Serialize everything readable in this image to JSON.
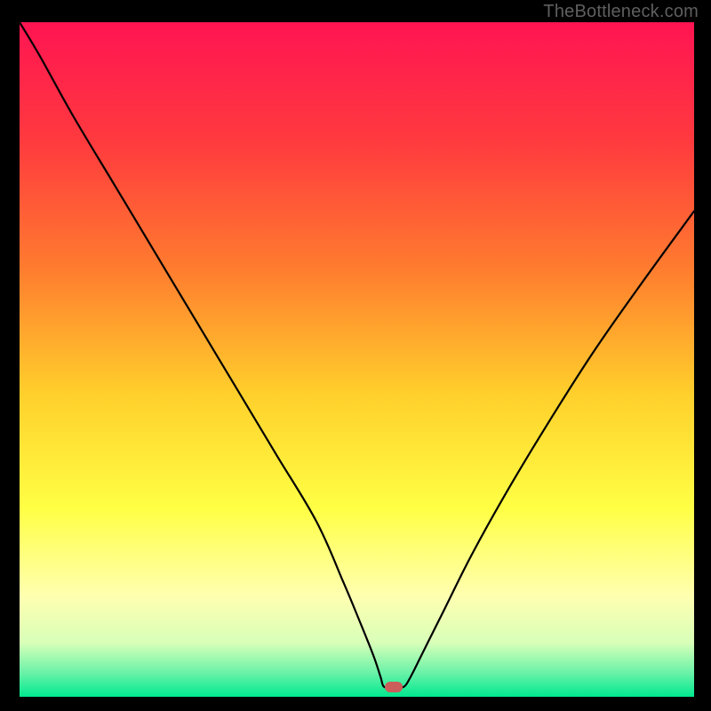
{
  "attribution": "TheBottleneck.com",
  "marker": {
    "x_frac": 0.555,
    "y_frac": 0.985
  },
  "chart_data": {
    "type": "line",
    "title": "",
    "xlabel": "",
    "ylabel": "",
    "xlim": [
      0,
      100
    ],
    "ylim": [
      0,
      100
    ],
    "grid": false,
    "legend": false,
    "gradient_stops": [
      {
        "offset": 0.0,
        "color": "#ff1452"
      },
      {
        "offset": 0.18,
        "color": "#ff3b3e"
      },
      {
        "offset": 0.36,
        "color": "#ff7a2f"
      },
      {
        "offset": 0.55,
        "color": "#ffcf2b"
      },
      {
        "offset": 0.72,
        "color": "#ffff44"
      },
      {
        "offset": 0.85,
        "color": "#ffffb0"
      },
      {
        "offset": 0.92,
        "color": "#d8ffb8"
      },
      {
        "offset": 0.965,
        "color": "#68f2a8"
      },
      {
        "offset": 1.0,
        "color": "#00e98f"
      }
    ],
    "series": [
      {
        "name": "bottleneck-curve",
        "x": [
          0.0,
          3.0,
          8.0,
          14.0,
          20.0,
          26.0,
          32.0,
          38.0,
          44.0,
          48.0,
          50.5,
          52.5,
          53.5,
          54.0,
          55.0,
          56.0,
          57.0,
          58.0,
          60.0,
          63.0,
          67.0,
          72.0,
          78.0,
          85.0,
          92.0,
          100.0
        ],
        "y": [
          100.0,
          95.0,
          86.0,
          76.0,
          66.0,
          56.0,
          46.0,
          36.0,
          26.0,
          17.0,
          11.0,
          6.0,
          3.0,
          1.5,
          1.5,
          1.5,
          1.5,
          3.0,
          7.0,
          13.0,
          21.0,
          30.0,
          40.0,
          51.0,
          61.0,
          72.0
        ]
      }
    ]
  }
}
